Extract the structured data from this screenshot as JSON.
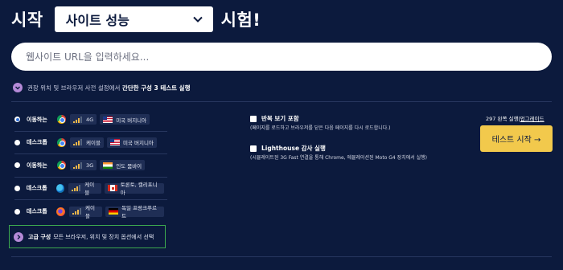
{
  "header": {
    "prefix": "시작",
    "selected_test": "사이트 성능",
    "suffix": "시험!"
  },
  "url_input": {
    "placeholder": "웹사이트 URL을 입력하세요...",
    "value": ""
  },
  "simple_config": {
    "prefix": "권장 위치 및 브라우저 사전 설정에서",
    "bold": "간단한 구성 3 테스트 실행"
  },
  "tests": [
    {
      "device": "이동하는",
      "network": "4G",
      "location": "미국 버지니아",
      "selected": true,
      "browser": "chrome",
      "flag": "us"
    },
    {
      "device": "데스크톱",
      "network": "케이블",
      "location": "미국 버지니아",
      "selected": false,
      "browser": "chrome",
      "flag": "us"
    },
    {
      "device": "이동하는",
      "network": "3G",
      "location": "인도 뭄바이",
      "selected": false,
      "browser": "chrome",
      "flag": "in"
    },
    {
      "device": "데스크톱",
      "network": "케이블",
      "location": "토론토, 캘리포니아",
      "selected": false,
      "browser": "edge",
      "flag": "ca"
    },
    {
      "device": "데스크톱",
      "network": "케이블",
      "location": "독일 프랑크푸르트",
      "selected": false,
      "browser": "firefox",
      "flag": "de"
    }
  ],
  "advanced": {
    "bold": "고급 구성",
    "text": "모든 브라우저, 위치 및 장치 옵션에서 선택"
  },
  "options": {
    "repeat_view": {
      "label": "반복 보기 포함",
      "desc": "(페이지를 로드하고 브라우저를 닫은 다음 페이지를 다시 로드합니다.)"
    },
    "lighthouse": {
      "label": "Lighthouse 감사 실행",
      "desc": "(시뮬레이트된 3G Fast 연결을 통해 Chrome, 에뮬레이션된 Moto G4 장치에서 실행)"
    }
  },
  "runs": {
    "text": "297 왼쪽 실행",
    "separator": "|",
    "upgrade": "업그레이드"
  },
  "start_button": "테스트 시작 →",
  "colors": {
    "background": "#0c1a3d",
    "accent_button": "#f2c94c",
    "toggle_purple": "#b58ad8",
    "advanced_border": "#3da94f"
  }
}
